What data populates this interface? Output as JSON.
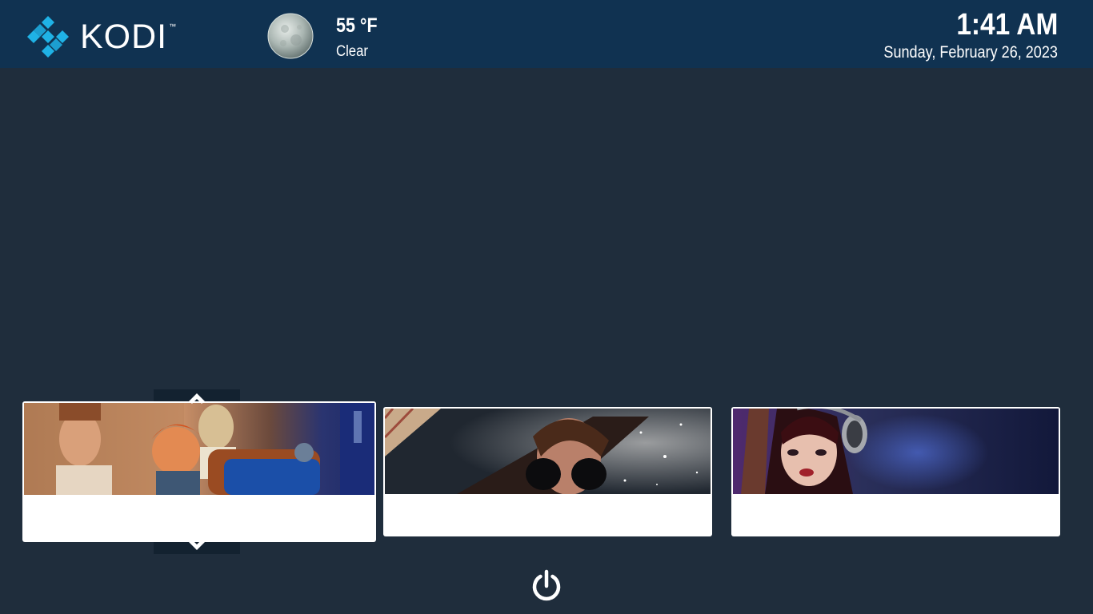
{
  "app": {
    "logo_text": "KODI",
    "logo_tm": "™",
    "brand_color": "#1fb2e6"
  },
  "weather": {
    "temperature": "55 °F",
    "condition": "Clear",
    "icon": "moon-icon"
  },
  "clock": {
    "time": "1:41 AM",
    "date": "Sunday, February 26, 2023"
  },
  "widgets": [
    {
      "name": "tv-shows-card",
      "title": ""
    },
    {
      "name": "music-videos-card",
      "title": ""
    },
    {
      "name": "music-card",
      "title": ""
    }
  ],
  "footer": {
    "power_icon": "power-icon"
  },
  "colors": {
    "background": "#1f2d3c",
    "topbar": "#103251",
    "card": "#ffffff"
  }
}
